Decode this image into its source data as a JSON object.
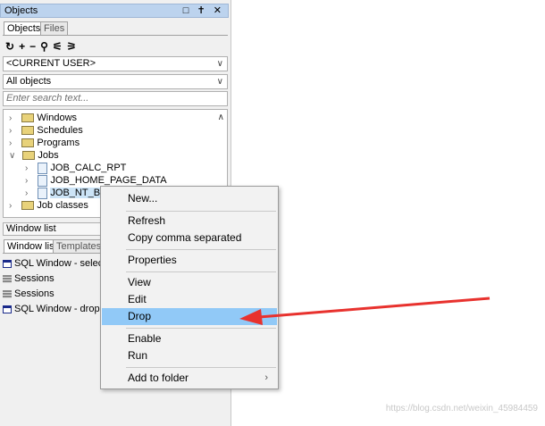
{
  "panel": {
    "title": "Objects",
    "title_buttons": "□ ✝ ✕",
    "tabs": [
      "Objects",
      "Files"
    ],
    "toolbar_icons": [
      "refresh-icon",
      "add-icon",
      "remove-icon",
      "find-icon",
      "filter-icon",
      "filter2-icon"
    ],
    "user_combo": "<CURRENT USER>",
    "objects_combo": "All objects",
    "search_placeholder": "Enter search text..."
  },
  "tree": {
    "items": [
      {
        "label": "Windows"
      },
      {
        "label": "Schedules"
      },
      {
        "label": "Programs"
      },
      {
        "label": "Jobs"
      },
      {
        "label": "JOB_CALC_RPT"
      },
      {
        "label": "JOB_HOME_PAGE_DATA"
      },
      {
        "label": "JOB_NT_BIL"
      },
      {
        "label": "Job classes"
      }
    ]
  },
  "window_list": {
    "label": "Window list",
    "tabs": [
      "Window list",
      "Templates"
    ],
    "items": [
      {
        "label": "SQL Window - select *",
        "icon": "sql"
      },
      {
        "label": "Sessions",
        "icon": "sess"
      },
      {
        "label": "Sessions",
        "icon": "sess"
      },
      {
        "label": "SQL Window - drop use",
        "icon": "sql"
      }
    ]
  },
  "context_menu": {
    "items": [
      "New...",
      "Refresh",
      "Copy comma separated",
      "Properties",
      "View",
      "Edit",
      "Drop",
      "Enable",
      "Run",
      "Add to folder"
    ],
    "highlighted": "Drop",
    "submenu_arrow": "›"
  },
  "watermark": "https://blog.csdn.net/weixin_45984459",
  "colors": {
    "highlight": "#91c9f7",
    "arrow": "#e8322e",
    "titlebar": "#bcd3ee"
  }
}
